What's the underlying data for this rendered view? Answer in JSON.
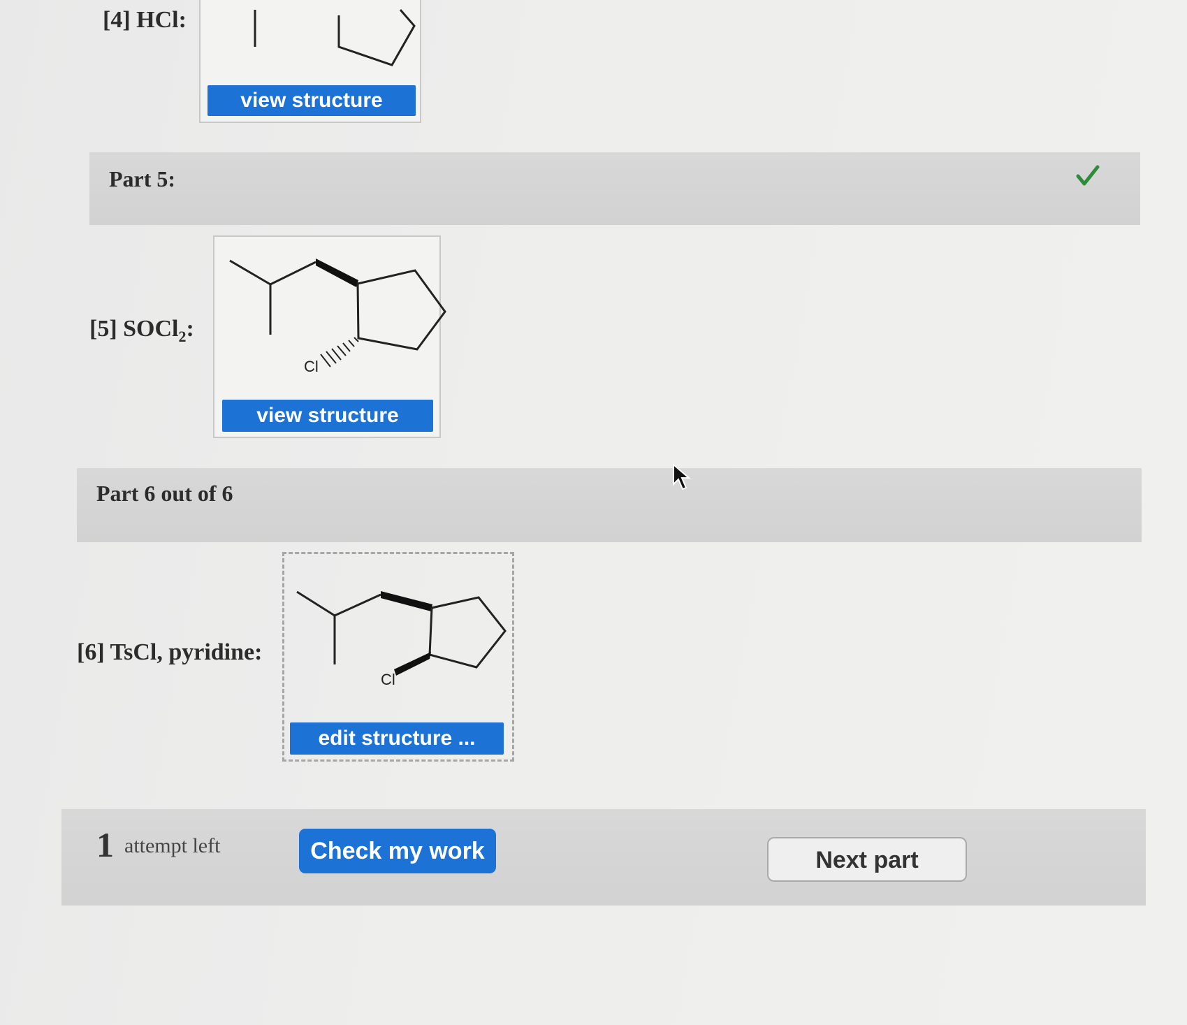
{
  "steps": [
    {
      "label": "[4] HCl:",
      "button_label": "view structure"
    },
    {
      "label": "[5] SOCl",
      "label_subscript": "2",
      "label_suffix": ":",
      "button_label": "view structure",
      "atom_label": "Cl"
    },
    {
      "label": "[6] TsCl, pyridine:",
      "button_label": "edit structure ...",
      "atom_label": "Cl"
    }
  ],
  "part5": {
    "title": "Part 5:",
    "status_icon": "check-icon",
    "status_color": "#2e8b3a"
  },
  "part6": {
    "title": "Part 6 out of 6"
  },
  "footer": {
    "attempts_count": "1",
    "attempts_text": "attempt left",
    "check_button": "Check my work",
    "next_button": "Next part"
  },
  "colors": {
    "accent_blue": "#1d73d5",
    "bar_grey": "#d4d4d4"
  }
}
